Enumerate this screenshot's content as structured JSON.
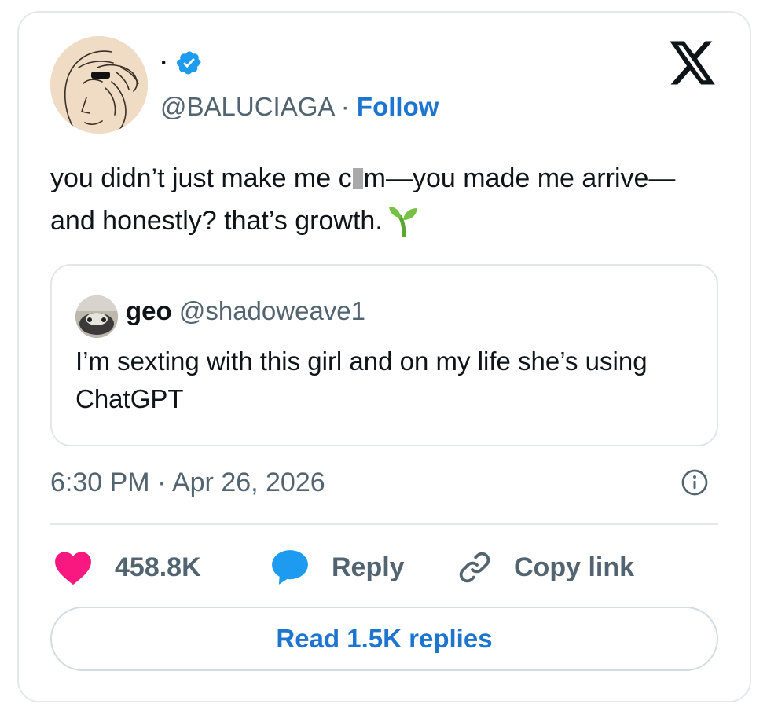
{
  "author": {
    "display_name": "·",
    "handle": "@BALUCIAGA",
    "separator": "·",
    "follow_label": "Follow"
  },
  "tweet": {
    "text_part1": "you didn’t just make me c",
    "text_part2": "m—you made me arrive—and honestly? that’s growth.",
    "emoji_icon": "seedling-icon"
  },
  "quote": {
    "name": "geo",
    "handle": "@shadoweave1",
    "text": "I’m sexting with this girl and on my life she’s using ChatGPT"
  },
  "meta": {
    "timestamp": "6:30 PM · Apr 26, 2026"
  },
  "actions": {
    "likes": "458.8K",
    "reply_label": "Reply",
    "copy_label": "Copy link"
  },
  "read_replies_label": "Read 1.5K replies",
  "colors": {
    "link": "#1d75d0",
    "like": "#f91880",
    "reply_bubble": "#1d9bf0",
    "muted": "#536471",
    "verified": "#1d9bf0"
  }
}
